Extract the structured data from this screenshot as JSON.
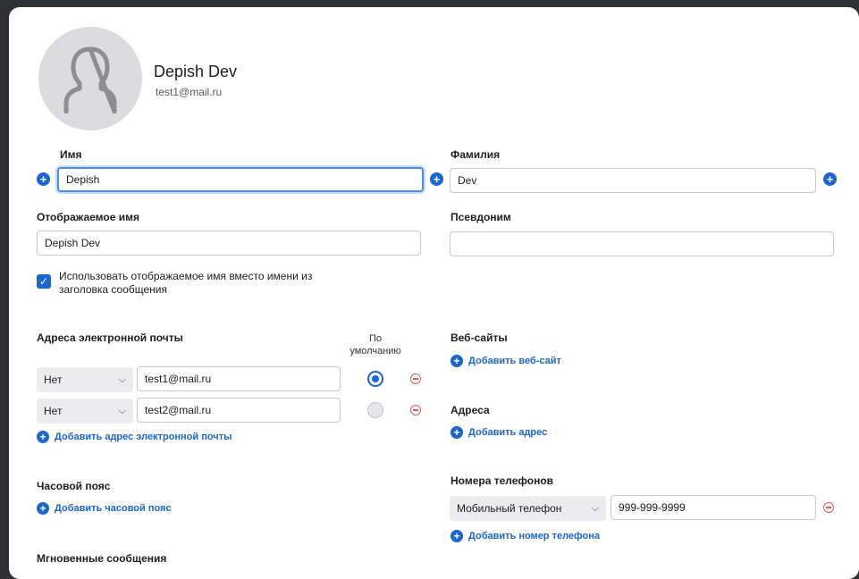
{
  "profile": {
    "name": "Depish Dev",
    "email": "test1@mail.ru"
  },
  "fields": {
    "first_name_label": "Имя",
    "first_name_value": "Depish",
    "last_name_label": "Фамилия",
    "last_name_value": "Dev",
    "display_name_label": "Отображаемое имя",
    "display_name_value": "Depish Dev",
    "nickname_label": "Псевдоним",
    "nickname_value": ""
  },
  "use_display_name": {
    "checked": true,
    "label_line1": "Использовать отображаемое имя вместо имени из",
    "label_line2": "заголовка сообщения"
  },
  "emails": {
    "label": "Адреса электронной почты",
    "default_header_line1": "По",
    "default_header_line2": "умолчанию",
    "rows": [
      {
        "type": "Нет",
        "address": "test1@mail.ru",
        "default": true
      },
      {
        "type": "Нет",
        "address": "test2@mail.ru",
        "default": false
      }
    ],
    "add_label": "Добавить адрес электронной почты"
  },
  "websites": {
    "label": "Веб-сайты",
    "add_label": "Добавить веб-сайт"
  },
  "addresses": {
    "label": "Адреса",
    "add_label": "Добавить адрес"
  },
  "timezone": {
    "label": "Часовой пояс",
    "add_label": "Добавить часовой пояс"
  },
  "phones": {
    "label": "Номера телефонов",
    "rows": [
      {
        "type": "Мобильный телефон",
        "number": "999-999-9999"
      }
    ],
    "add_label": "Добавить номер телефона"
  },
  "im": {
    "label": "Мгновенные сообщения"
  },
  "colors": {
    "accent": "#1a66d2",
    "remove": "#e85a5a",
    "focus": "#4a90e2"
  }
}
